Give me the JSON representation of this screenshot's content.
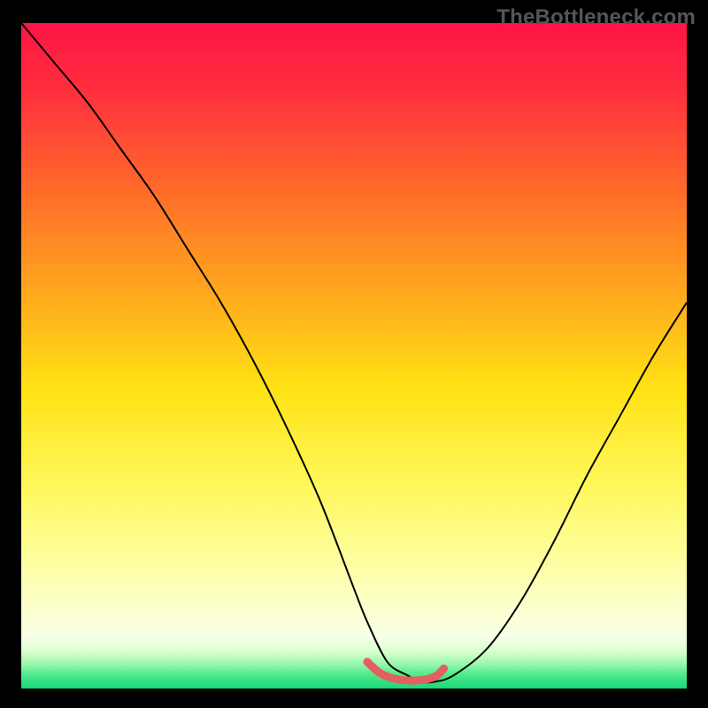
{
  "watermark": "TheBottleneck.com",
  "chart_data": {
    "type": "line",
    "title": "",
    "xlabel": "",
    "ylabel": "",
    "xlim": [
      0,
      100
    ],
    "ylim": [
      0,
      100
    ],
    "grid": false,
    "legend": false,
    "gradient": {
      "stops": [
        {
          "offset": 0.0,
          "color": "#ff1446"
        },
        {
          "offset": 0.1,
          "color": "#ff2e3e"
        },
        {
          "offset": 0.25,
          "color": "#ff6a2a"
        },
        {
          "offset": 0.4,
          "color": "#ffa61e"
        },
        {
          "offset": 0.55,
          "color": "#ffe214"
        },
        {
          "offset": 0.7,
          "color": "#fff85e"
        },
        {
          "offset": 0.82,
          "color": "#fdffa6"
        },
        {
          "offset": 0.89,
          "color": "#fcffd4"
        },
        {
          "offset": 0.922,
          "color": "#f6ffe8"
        },
        {
          "offset": 0.945,
          "color": "#d8ffcf"
        },
        {
          "offset": 0.962,
          "color": "#9cf7ad"
        },
        {
          "offset": 0.98,
          "color": "#4be98a"
        },
        {
          "offset": 1.0,
          "color": "#17d877"
        }
      ]
    },
    "series": [
      {
        "name": "bottleneck-curve",
        "stroke": "#000000",
        "stroke_width": 2,
        "x": [
          0,
          5,
          10,
          15,
          20,
          25,
          30,
          35,
          40,
          45,
          50,
          52,
          55,
          58,
          60,
          62,
          65,
          70,
          75,
          80,
          85,
          90,
          95,
          100
        ],
        "values": [
          100,
          94,
          88,
          81,
          74,
          66,
          58,
          49,
          39,
          28,
          15,
          10,
          4,
          2,
          1,
          1,
          2,
          6,
          13,
          22,
          32,
          41,
          50,
          58
        ]
      },
      {
        "name": "optimal-range-marker",
        "stroke": "#e26060",
        "stroke_width": 9,
        "linecap": "round",
        "x": [
          52.0,
          53.5,
          55.0,
          57.0,
          59.0,
          61.0,
          62.5,
          63.5
        ],
        "values": [
          4.0,
          2.6,
          1.8,
          1.3,
          1.2,
          1.4,
          2.0,
          3.0
        ]
      }
    ],
    "optimal_range_dots": {
      "stroke": "#e26060",
      "r": 4.5,
      "points": [
        {
          "x": 52.0,
          "y": 4.0
        },
        {
          "x": 63.5,
          "y": 3.0
        }
      ]
    }
  }
}
